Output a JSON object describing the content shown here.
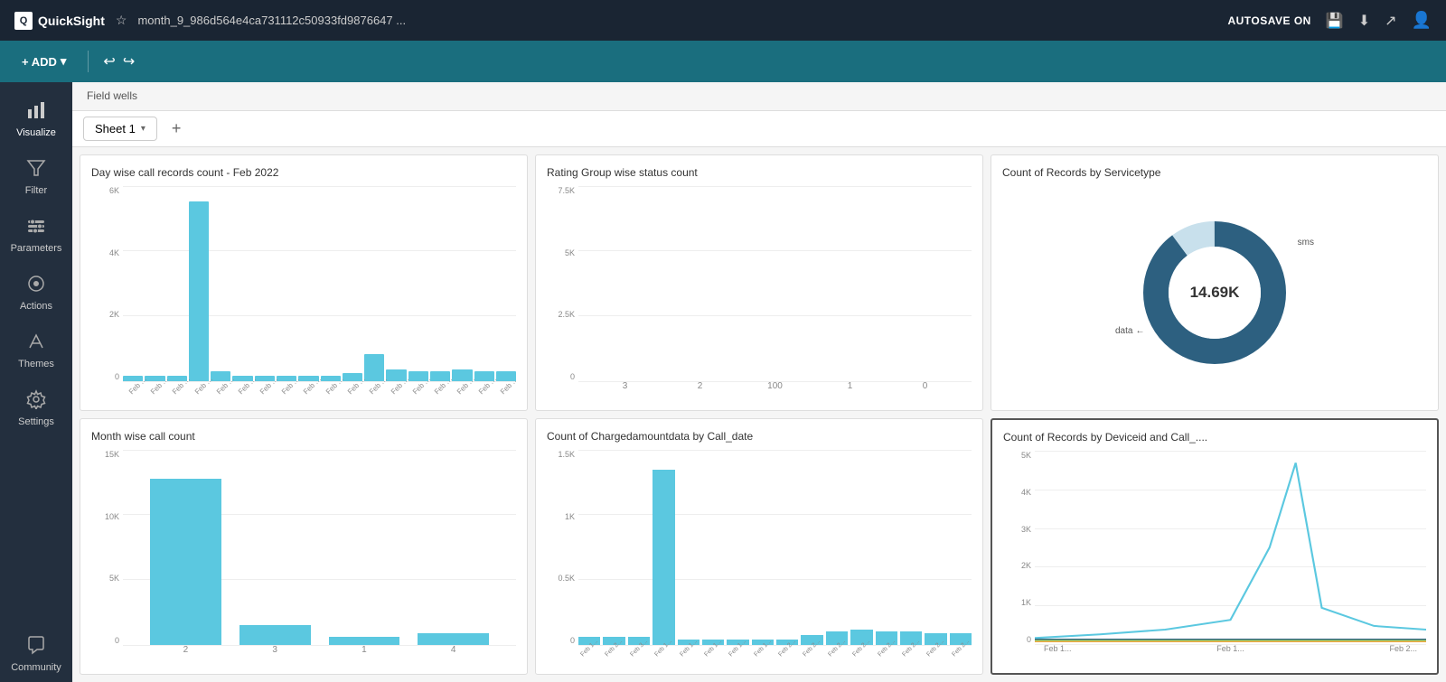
{
  "topbar": {
    "logo_text": "QuickSight",
    "tab_title": "month_9_986d564e4ca731112c50933fd9876647 ...",
    "autosave_label": "AUTOSAVE ON"
  },
  "toolbar": {
    "add_label": "+ ADD",
    "add_chevron": "▾"
  },
  "sidebar": {
    "items": [
      {
        "id": "visualize",
        "label": "Visualize",
        "icon": "📊"
      },
      {
        "id": "filter",
        "label": "Filter",
        "icon": "⊘"
      },
      {
        "id": "parameters",
        "label": "Parameters",
        "icon": "⊞"
      },
      {
        "id": "actions",
        "label": "Actions",
        "icon": "◎"
      },
      {
        "id": "themes",
        "label": "Themes",
        "icon": "✏"
      },
      {
        "id": "settings",
        "label": "Settings",
        "icon": "⚙"
      },
      {
        "id": "community",
        "label": "Community",
        "icon": "💬"
      }
    ]
  },
  "field_wells": {
    "label": "Field wells"
  },
  "sheet_tab": {
    "label": "Sheet 1"
  },
  "charts": {
    "chart1": {
      "title": "Day wise call records count - Feb 2022",
      "y_labels": [
        "6K",
        "4K",
        "2K",
        "0"
      ],
      "bars": [
        5,
        4,
        4,
        100,
        8,
        4,
        4,
        4,
        4,
        4,
        6,
        18,
        7,
        5,
        4,
        5,
        4,
        4
      ],
      "x_labels": [
        "Feb 1...",
        "Feb 2...",
        "Feb 3...",
        "Feb 1...",
        "Feb 1...",
        "Feb 1...",
        "Feb 1...",
        "Feb 1...",
        "Feb 1...",
        "Feb 2...",
        "Feb 2...",
        "Feb 2...",
        "Feb 2...",
        "Feb 2..."
      ],
      "bar_color": "#5bc8e0"
    },
    "chart2": {
      "title": "Rating Group wise status count",
      "y_labels": [
        "7.5K",
        "5K",
        "2.5K",
        "0"
      ],
      "x_labels": [
        "3",
        "2",
        "100",
        "1",
        "0"
      ],
      "color_orange": "#f0a340",
      "color_blue": "#2d6080",
      "color_light": "#aadde8"
    },
    "chart3": {
      "title": "Count of Records by Servicetype",
      "center_value": "14.69K",
      "legend_sms": "sms",
      "legend_data": "data",
      "color_outer": "#2d6080",
      "color_inner": "#f5f5f5"
    },
    "chart4": {
      "title": "Month wise call count",
      "y_labels": [
        "15K",
        "10K",
        "5K",
        "0"
      ],
      "x_labels": [
        "2",
        "3",
        "1",
        "4"
      ],
      "bar_color": "#5bc8e0",
      "bars": [
        100,
        14,
        4,
        6
      ]
    },
    "chart5": {
      "title": "Count of Chargedamountdata by Call_date",
      "y_labels": [
        "1.5K",
        "1K",
        "0.5K",
        "0"
      ],
      "bar_color": "#5bc8e0",
      "x_labels": [
        "Feb 1...",
        "Feb 2...",
        "Feb 3...",
        "Feb 1...",
        "Feb 1...",
        "Feb 1...",
        "Feb 1...",
        "Feb 1...",
        "Feb 2...",
        "Feb 2...",
        "Feb 2...",
        "Feb 2...",
        "Feb 2..."
      ]
    },
    "chart6": {
      "title": "Count of Records by Deviceid and Call_....",
      "y_labels": [
        "5K",
        "4K",
        "3K",
        "2K",
        "1K",
        "0"
      ],
      "x_labels": [
        "Feb 1...",
        "Feb 1...",
        "Feb 2..."
      ],
      "selected": true
    }
  }
}
